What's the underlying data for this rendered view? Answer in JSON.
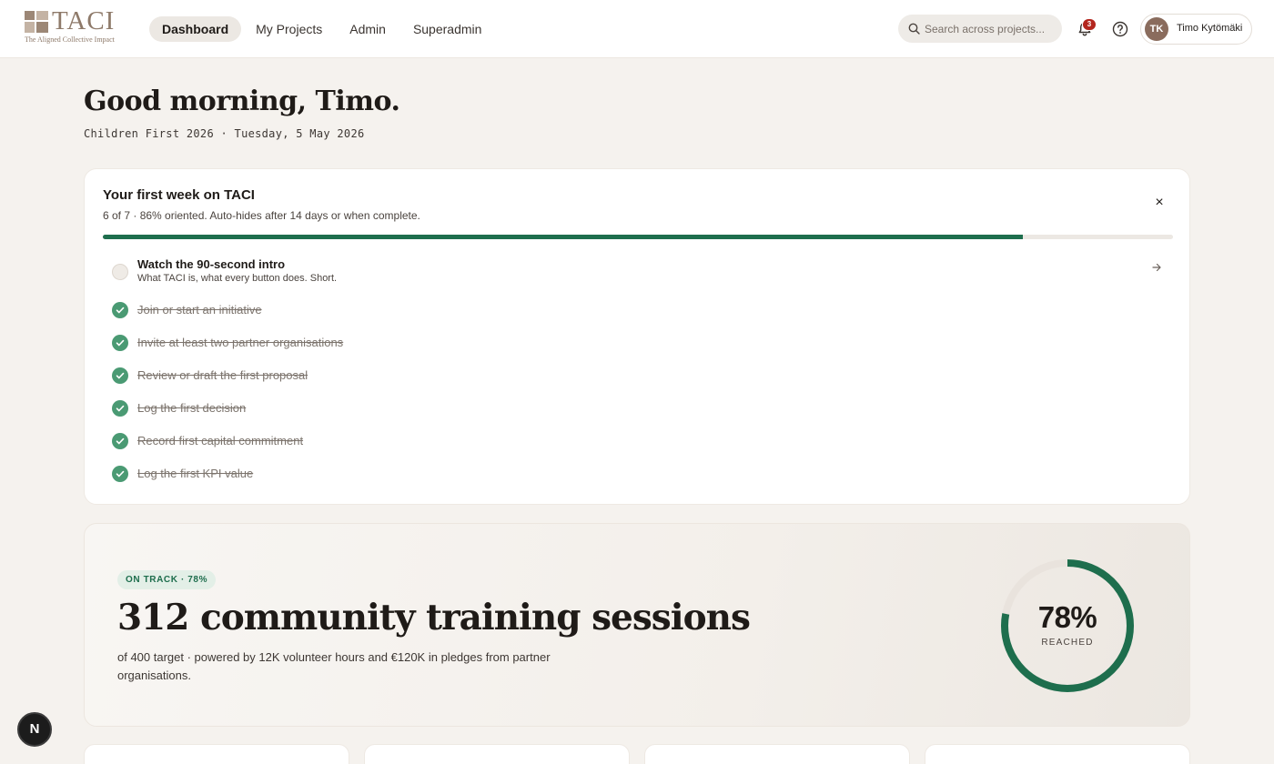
{
  "brand": {
    "name": "TACI",
    "tagline": "The Aligned Collective Impact",
    "color": "#8e7a6a"
  },
  "nav": {
    "items": [
      {
        "label": "Dashboard",
        "active": true
      },
      {
        "label": "My Projects",
        "active": false
      },
      {
        "label": "Admin",
        "active": false
      },
      {
        "label": "Superadmin",
        "active": false
      }
    ]
  },
  "search": {
    "placeholder": "Search across projects...",
    "icon": "search-icon"
  },
  "notifications": {
    "count": "3",
    "icon": "bell-icon"
  },
  "help": {
    "icon": "help-circle-icon"
  },
  "user": {
    "initials": "TK",
    "name": "Timo Kytömäki"
  },
  "greeting": {
    "title": "Good morning, Timo.",
    "subline": "Children First 2026 · Tuesday, 5 May 2026"
  },
  "onboarding": {
    "title": "Your first week on TACI",
    "subtitle": "6 of 7 · 86% oriented. Auto-hides after 14 days or when complete.",
    "progress_percent": 86,
    "close_glyph": "×",
    "tasks": [
      {
        "label": "Watch the 90-second intro",
        "description": "What TACI is, what every button does. Short.",
        "done": false
      },
      {
        "label": "Join or start an initiative",
        "done": true
      },
      {
        "label": "Invite at least two partner organisations",
        "done": true
      },
      {
        "label": "Review or draft the first proposal",
        "done": true
      },
      {
        "label": "Log the first decision",
        "done": true
      },
      {
        "label": "Record first capital commitment",
        "done": true
      },
      {
        "label": "Log the first KPI value",
        "done": true
      }
    ]
  },
  "hero": {
    "badge": "ON TRACK · 78%",
    "title": "312 community training sessions",
    "description": "of 400 target · powered by 12K volunteer hours and €120K in pledges from partner organisations.",
    "progress_percent": 78,
    "ring_value": "78%",
    "ring_label": "REACHED",
    "accent_color": "#1e6e4d"
  },
  "floating_badge": {
    "label": "N"
  }
}
